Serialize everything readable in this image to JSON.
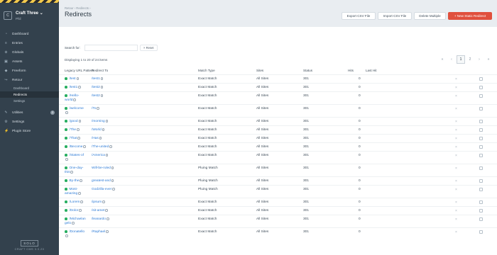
{
  "sidebar": {
    "site_initial": "C",
    "site_name": "Craft Three",
    "site_sub": "Phil",
    "nav": [
      {
        "label": "Dashboard",
        "icon": "gauge-icon"
      },
      {
        "label": "Entries",
        "icon": "entries-icon"
      },
      {
        "label": "Globals",
        "icon": "globe-icon"
      },
      {
        "label": "Assets",
        "icon": "image-icon"
      },
      {
        "label": "Freeform",
        "icon": "freeform-icon"
      },
      {
        "label": "Retour",
        "icon": "retour-icon"
      }
    ],
    "retour_sub": [
      "Dashboard",
      "Redirects",
      "Settings"
    ],
    "nav2": [
      {
        "label": "Utilities",
        "icon": "wrench-icon",
        "badge": "2"
      },
      {
        "label": "Settings",
        "icon": "gear-icon"
      },
      {
        "label": "Plugin Store",
        "icon": "plug-icon"
      }
    ],
    "edition": "SOLO",
    "craft_version": "CRAFT CMS 3.0.20"
  },
  "header": {
    "breadcrumb": "Retour › Redirects ›",
    "title": "Redirects",
    "buttons": {
      "export": "Export CSV File",
      "import": "Import CSV File",
      "delete": "Delete Multiple",
      "new": "+ New Static Redirect"
    }
  },
  "search": {
    "label": "Search for:",
    "value": "",
    "reset": "× Reset"
  },
  "displaying": "Displaying 1 to 20 of 24 items",
  "pagination": {
    "first": "«",
    "prev": "‹",
    "pages": [
      "1",
      "2"
    ],
    "next": "›",
    "last": "»"
  },
  "table": {
    "headers": [
      "Legacy URL Pattern",
      "Redirect To",
      "Match Type",
      "Sites",
      "Status",
      "Hits",
      "Last Hit"
    ],
    "rows": [
      {
        "legacy": [
          "/test"
        ],
        "redirect": [
          "/test1"
        ],
        "match": "Exact Match",
        "sites": "All Sites",
        "status": "301",
        "hits": "0"
      },
      {
        "legacy": [
          "/test1"
        ],
        "redirect": [
          "/test2"
        ],
        "match": "Exact Match",
        "sites": "All Sites",
        "status": "301",
        "hits": "0"
      },
      {
        "legacy": [
          "/Hello-",
          "world"
        ],
        "redirect": [
          "/test2"
        ],
        "match": "Exact Match",
        "sites": "All Sites",
        "status": "301",
        "hits": "0"
      },
      {
        "legacy": [
          "/welcome",
          ""
        ],
        "redirect": [
          "/To"
        ],
        "match": "Exact Match",
        "sites": "All Sites",
        "status": "301",
        "hits": "0"
      },
      {
        "legacy": [
          "/good"
        ],
        "redirect": [
          "/morning"
        ],
        "match": "Exact Match",
        "sites": "All Sites",
        "status": "301",
        "hits": "0"
      },
      {
        "legacy": [
          "/The"
        ],
        "redirect": [
          "/World"
        ],
        "match": "Exact Match",
        "sites": "All Sites",
        "status": "301",
        "hits": "0"
      },
      {
        "legacy": [
          "/That"
        ],
        "redirect": [
          "/Has"
        ],
        "match": "Exact Match",
        "sites": "All Sites",
        "status": "301",
        "hits": "0"
      },
      {
        "legacy": [
          "/Become"
        ],
        "redirect": [
          "/The-united"
        ],
        "match": "Exact Match",
        "sites": "All Sites",
        "status": "301",
        "hits": "0"
      },
      {
        "legacy": [
          "/States-of",
          ""
        ],
        "redirect": [
          "/America"
        ],
        "match": "Exact Match",
        "sites": "All Sites",
        "status": "301",
        "hits": "0"
      },
      {
        "legacy": [
          "One-day-",
          "this"
        ],
        "redirect": [
          "Will-be-ruled"
        ],
        "match": "Pluing Match",
        "sites": "All Sites",
        "status": "301",
        "hits": "0"
      },
      {
        "legacy": [
          "By-the"
        ],
        "redirect": [
          "greatest-and"
        ],
        "match": "Pluing Match",
        "sites": "All Sites",
        "status": "301",
        "hits": "0"
      },
      {
        "legacy": [
          "Most-",
          "amazing"
        ],
        "redirect": [
          "Godzilla-ever"
        ],
        "match": "Pluing Match",
        "sites": "All Sites",
        "status": "301",
        "hits": "0"
      },
      {
        "legacy": [
          "/Lorem"
        ],
        "redirect": [
          "/ipsum"
        ],
        "match": "Exact Match",
        "sites": "All Sites",
        "status": "301",
        "hits": "0"
      },
      {
        "legacy": [
          "/Dolor"
        ],
        "redirect": [
          "/sit-amet"
        ],
        "match": "Exact Match",
        "sites": "All Sites",
        "status": "301",
        "hits": "0"
      },
      {
        "legacy": [
          "/Michaelan",
          "gelo"
        ],
        "redirect": [
          "/leanardo"
        ],
        "match": "Exact Match",
        "sites": "All Sites",
        "status": "301",
        "hits": "0"
      },
      {
        "legacy": [
          "/Donatello",
          ""
        ],
        "redirect": [
          "/Raphael"
        ],
        "match": "Exact Match",
        "sites": "All Sites",
        "status": "301",
        "hits": "0"
      }
    ]
  },
  "colors": {
    "accent": "#e0503d",
    "link": "#2d7bd6",
    "status_dot": "#27ae60",
    "sidebar": "#33414d"
  }
}
